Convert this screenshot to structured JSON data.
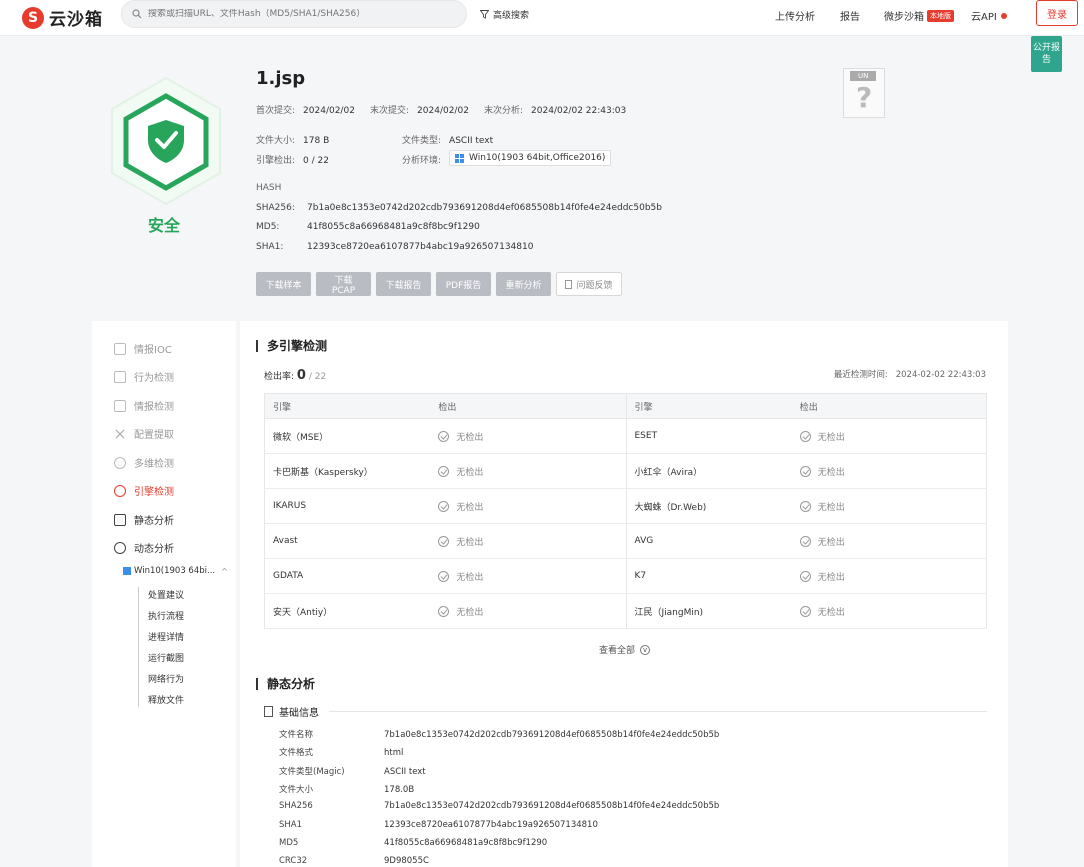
{
  "header": {
    "logo_mark": "S",
    "logo_text": "云沙箱",
    "search_placeholder": "搜索或扫描URL、文件Hash（MD5/SHA1/SHA256）",
    "advanced_search": "高级搜索",
    "nav_upload": "上传分析",
    "nav_report": "报告",
    "nav_micro": "微步沙箱",
    "nav_micro_badge": "本地版",
    "nav_api": "云API",
    "login": "登录"
  },
  "public_report": "公开报告",
  "summary": {
    "verdict": "安全",
    "file_name": "1.jsp",
    "first_submit_label": "首次提交:",
    "first_submit": "2024/02/02",
    "last_submit_label": "末次提交:",
    "last_submit": "2024/02/02",
    "last_analysis_label": "末次分析:",
    "last_analysis": "2024/02/02 22:43:03",
    "file_size_label": "文件大小:",
    "file_size": "178 B",
    "file_type_label": "文件类型:",
    "file_type": "ASCII text",
    "engine_detect_label": "引擎检出:",
    "engine_detect": "0 / 22",
    "env_label": "分析环境:",
    "env": "Win10(1903 64bit,Office2016)",
    "hash_title": "HASH",
    "sha256_label": "SHA256:",
    "sha256": "7b1a0e8c1353e0742d202cdb793691208d4ef0685508b14f0fe4e24eddc50b5b",
    "md5_label": "MD5:",
    "md5": "41f8055c8a66968481a9c8f8bc9f1290",
    "sha1_label": "SHA1:",
    "sha1": "12393ce8720ea6107877b4abc19a926507134810",
    "unknown_tag": "UN",
    "unknown_glyph": "?"
  },
  "actions": {
    "download_sample": "下载样本",
    "download_pcap": "下载PCAP",
    "download_report": "下载报告",
    "pdf_report": "PDF报告",
    "reanalyze": "重新分析",
    "feedback": "问题反馈"
  },
  "sidebar": {
    "items": [
      "情报IOC",
      "行为检测",
      "情报检测",
      "配置提取",
      "多维检测",
      "引擎检测",
      "静态分析",
      "动态分析"
    ],
    "env_item": "Win10(1903 64bi...",
    "env_caret": "^",
    "tree": [
      "处置建议",
      "执行流程",
      "进程详情",
      "运行截图",
      "网络行为",
      "释放文件"
    ]
  },
  "multi_engine": {
    "title": "多引擎检测",
    "rate_label": "检出率:",
    "rate_value": "0",
    "rate_total": "/ 22",
    "last_time_label": "最近检测时间:",
    "last_time": "2024-02-02 22:43:03",
    "headers": [
      "引擎",
      "检出",
      "引擎",
      "检出"
    ],
    "no_detect": "无检出",
    "rows": [
      [
        "微软（MSE）",
        "ESET"
      ],
      [
        "卡巴斯基（Kaspersky）",
        "小红伞（Avira）"
      ],
      [
        "IKARUS",
        "大蜘蛛（Dr.Web)"
      ],
      [
        "Avast",
        "AVG"
      ],
      [
        "GDATA",
        "K7"
      ],
      [
        "安天（Antiy）",
        "江民（JiangMin)"
      ]
    ],
    "view_all": "查看全部",
    "view_all_icon": "v"
  },
  "static_analysis": {
    "title": "静态分析",
    "basic_info": "基础信息",
    "rows": [
      [
        "文件名称",
        "7b1a0e8c1353e0742d202cdb793691208d4ef0685508b14f0fe4e24eddc50b5b"
      ],
      [
        "文件格式",
        "html"
      ],
      [
        "文件类型(Magic)",
        "ASCII text"
      ],
      [
        "文件大小",
        "178.0B"
      ],
      [
        "SHA256",
        "7b1a0e8c1353e0742d202cdb793691208d4ef0685508b14f0fe4e24eddc50b5b"
      ],
      [
        "SHA1",
        "12393ce8720ea6107877b4abc19a926507134810"
      ],
      [
        "MD5",
        "41f8055c8a66968481a9c8f8bc9f1290"
      ],
      [
        "CRC32",
        "9D98055C"
      ]
    ]
  },
  "colors": {
    "brand": "#e73b2e",
    "safe": "#27a55a",
    "public": "#2fa58e"
  }
}
